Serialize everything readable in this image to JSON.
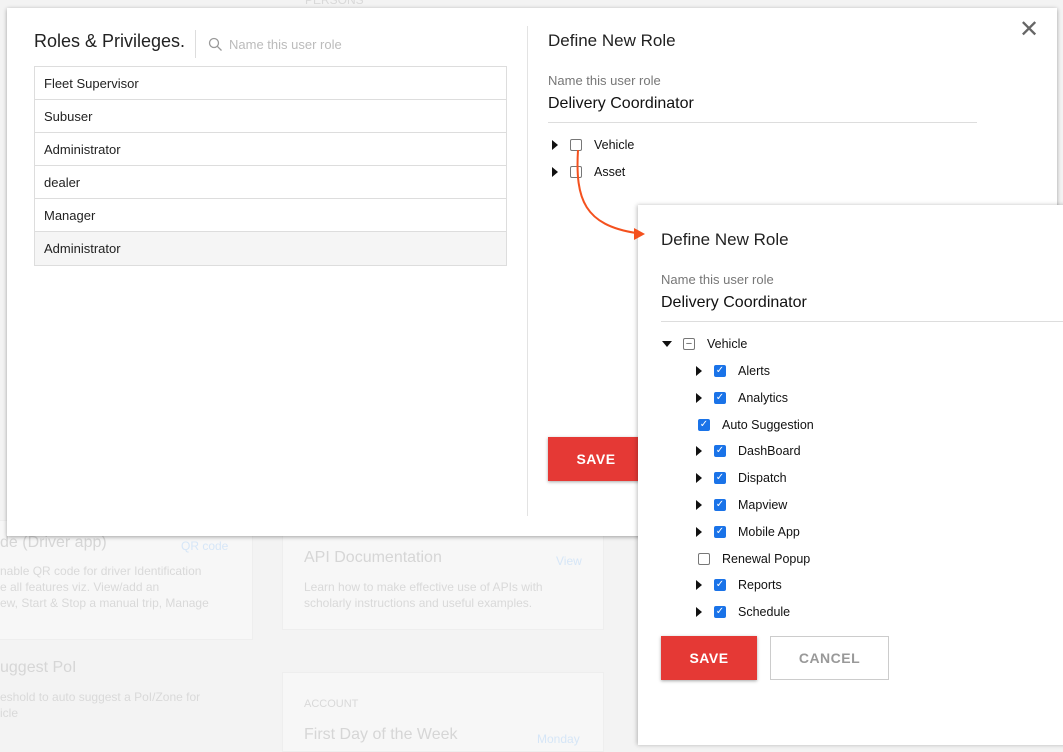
{
  "background": {
    "persons": "PERSONS",
    "qr_title": "de (Driver app)",
    "qr_link": "QR code",
    "qr_desc": [
      "nable QR code for driver Identification",
      "e all features viz. View/add an",
      "ew, Start & Stop a manual trip, Manage"
    ],
    "poi_title": "uggest PoI",
    "poi_desc": [
      "eshold to auto suggest a PoI/Zone for",
      "icle"
    ],
    "api_title": "API Documentation",
    "api_link": "View",
    "api_desc": [
      "Learn how to make effective use of APIs with",
      "scholarly instructions and useful examples."
    ],
    "account": "ACCOUNT",
    "first_day": "First Day of the Week",
    "first_day_value": "Monday"
  },
  "modal": {
    "title": "Roles & Privileges.",
    "search_placeholder": "Name this user role",
    "roles": [
      "Fleet Supervisor",
      "Subuser",
      "Administrator",
      "dealer",
      "Manager",
      "Administrator"
    ],
    "define_title": "Define New Role",
    "name_label": "Name this user role",
    "name_value": "Delivery Coordinator",
    "tree": [
      {
        "label": "Vehicle",
        "checked": false
      },
      {
        "label": "Asset",
        "checked": false
      }
    ],
    "save": "SAVE"
  },
  "expanded": {
    "title": "Define New Role",
    "name_label": "Name this user role",
    "name_value": "Delivery Coordinator",
    "parent": {
      "label": "Vehicle",
      "state": "partial"
    },
    "children": [
      {
        "label": "Alerts",
        "checked": true,
        "expandable": true
      },
      {
        "label": "Analytics",
        "checked": true,
        "expandable": true
      },
      {
        "label": "Auto Suggestion",
        "checked": true,
        "expandable": false
      },
      {
        "label": "DashBoard",
        "checked": true,
        "expandable": true
      },
      {
        "label": "Dispatch",
        "checked": true,
        "expandable": true
      },
      {
        "label": "Mapview",
        "checked": true,
        "expandable": true
      },
      {
        "label": "Mobile App",
        "checked": true,
        "expandable": true
      },
      {
        "label": "Renewal Popup",
        "checked": false,
        "expandable": false
      },
      {
        "label": "Reports",
        "checked": true,
        "expandable": true
      },
      {
        "label": "Schedule",
        "checked": true,
        "expandable": true
      }
    ],
    "save": "SAVE",
    "cancel": "CANCEL"
  },
  "colors": {
    "accent": "#e53935",
    "checkbox": "#1a73e8",
    "arrow": "#f4511e"
  }
}
